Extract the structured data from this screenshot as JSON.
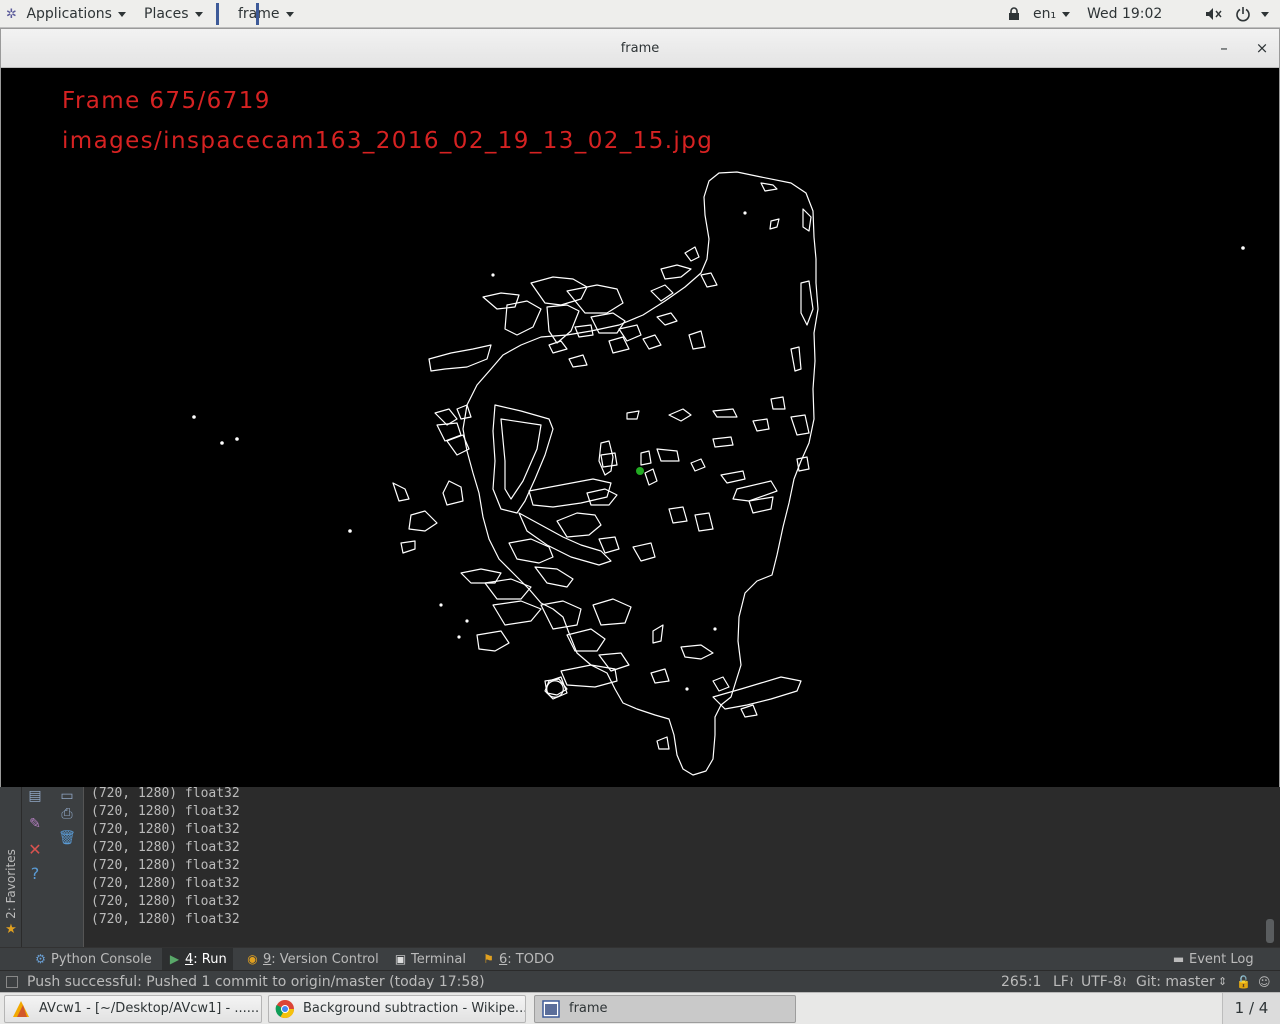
{
  "top_panel": {
    "applications": "Applications",
    "places": "Places",
    "window_menu": "frame",
    "input_source": "en₁",
    "clock": "Wed 19:02"
  },
  "frame_window": {
    "title": "frame",
    "minimize": "–",
    "close": "×",
    "frame_counter": "Frame 675/6719",
    "image_path": "images/inspacecam163_2016_02_19_13_02_15.jpg"
  },
  "console": {
    "lines": [
      "(720, 1280) float32",
      "(720, 1280) float32",
      "(720, 1280) float32",
      "(720, 1280) float32",
      "(720, 1280) float32",
      "(720, 1280) float32",
      "(720, 1280) float32",
      "(720, 1280) float32"
    ],
    "favorites_label": "2: Favorites"
  },
  "tool_windows": {
    "python_console": "Python Console",
    "run_num": "4",
    "run": ": Run",
    "vcs_num": "9",
    "vcs": ": Version Control",
    "terminal": "Terminal",
    "todo_num": "6",
    "todo": ": TODO",
    "event_log": "Event Log"
  },
  "status_bar": {
    "message": "Push successful: Pushed 1 commit to origin/master (today 17:58)",
    "position": "265:1",
    "line_sep": "LF≀",
    "encoding": "UTF-8≀",
    "vcs_branch": "Git: master",
    "colors": {
      "bg": "#3c3f41",
      "text": "#bbbbbb"
    }
  },
  "taskbar": {
    "tasks": [
      "AVcw1 - [~/Desktop/AVcw1] - ......",
      "Background subtraction - Wikipe...",
      "frame"
    ],
    "workspace": "1 / 4"
  },
  "colors": {
    "overlay_text": "#d62222",
    "marker": "#22aa22",
    "edges": "#ffffff"
  }
}
